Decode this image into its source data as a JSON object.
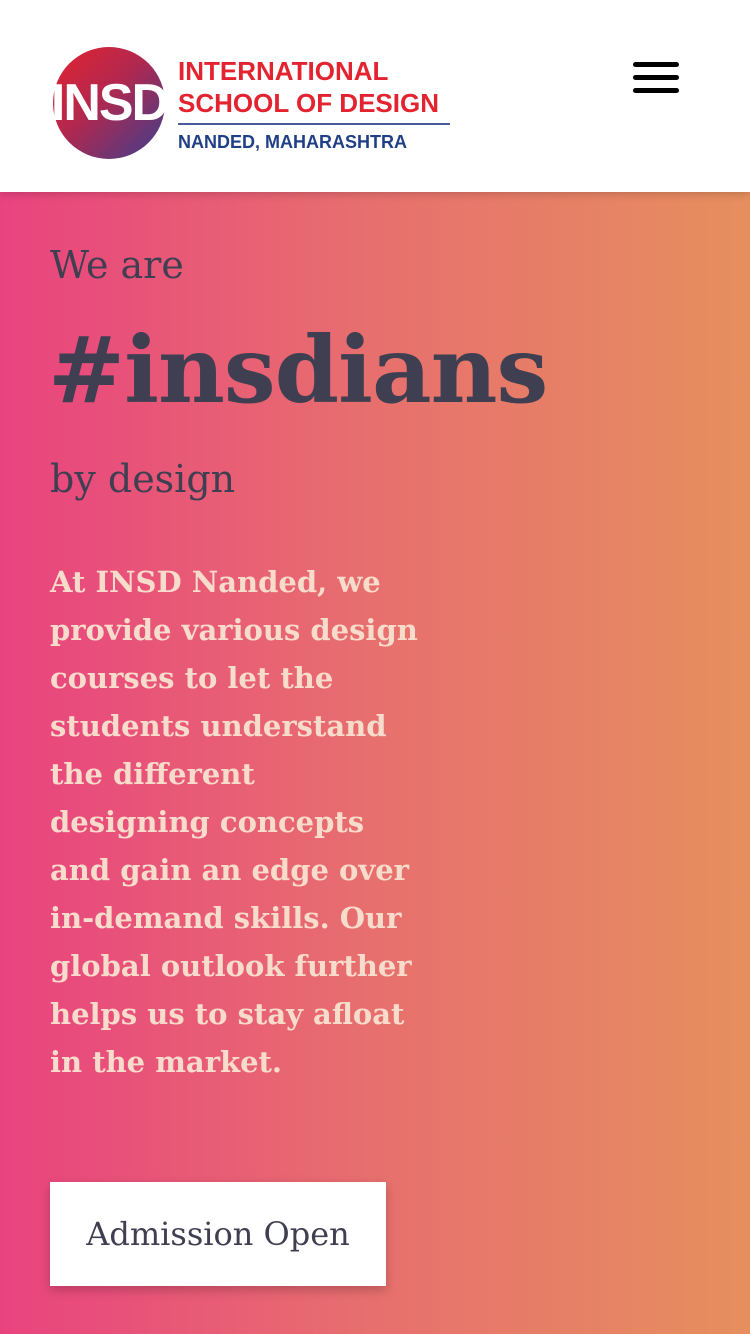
{
  "header": {
    "logo": {
      "badge_text": "INSD",
      "line1": "INTERNATIONAL",
      "line2": "SCHOOL OF DESIGN",
      "line3": "NANDED, MAHARASHTRA"
    },
    "menu_icon": "hamburger-menu-icon"
  },
  "hero": {
    "eyebrow": "We are",
    "title": "#insdians",
    "subtitle": "by design",
    "body": "At INSD Nanded, we provide various design courses to let the students understand the different designing concepts and gain an edge over in-demand skills. Our global outlook further helps us to stay afloat in the market.",
    "cta_label": "Admission Open"
  },
  "colors": {
    "brand_red": "#e3232f",
    "brand_blue": "#1f3f87",
    "gradient_start": "#e9437f",
    "gradient_end": "#e68f5e",
    "heading_text": "#3f3f51",
    "body_text": "#f8dccb"
  }
}
